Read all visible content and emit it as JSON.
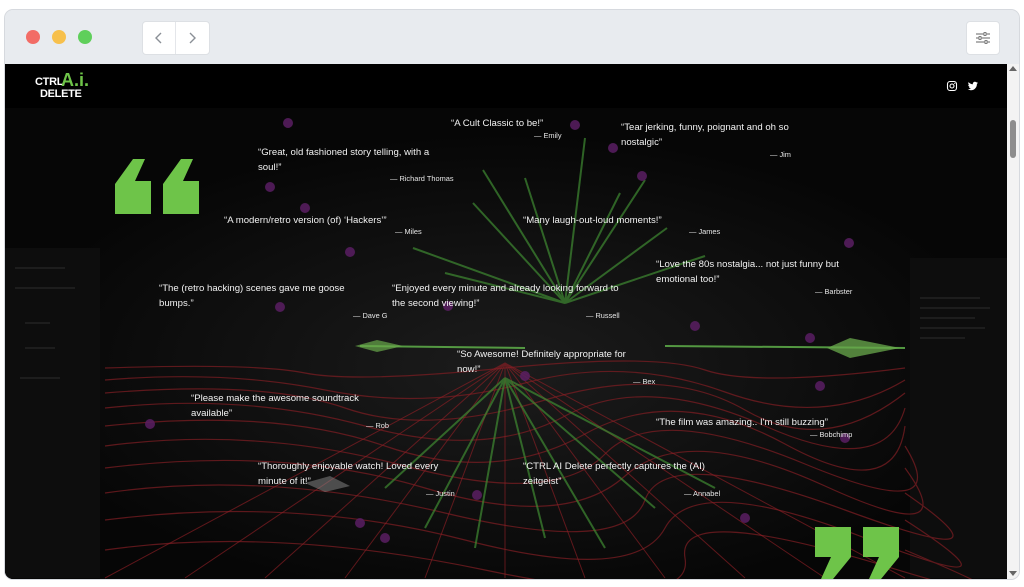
{
  "browser": {
    "back_icon": "chevron-left-icon",
    "forward_icon": "chevron-right-icon",
    "settings_icon": "sliders-icon"
  },
  "site": {
    "logo": {
      "line1": "CTRL",
      "ai": "A.i.",
      "line2": "DELETE"
    },
    "social": [
      "instagram-icon",
      "twitter-icon"
    ],
    "accent_color": "#6ec449"
  },
  "testimonials": [
    {
      "quote": "“A Cult Classic to be!”",
      "author": "— Emily"
    },
    {
      "quote": "“Tear jerking, funny, poignant and oh so nostalgic”",
      "author": "— Jim"
    },
    {
      "quote": "“Great, old fashioned story telling, with a soul!”",
      "author": "— Richard Thomas"
    },
    {
      "quote": "“A modern/retro version (of) ‘Hackers’”",
      "author": "— Miles"
    },
    {
      "quote": "“Many laugh-out-loud moments!”",
      "author": "— James"
    },
    {
      "quote": "“Love the 80s nostalgia... not just funny but emotional too!”",
      "author": "— Barbster"
    },
    {
      "quote": "“The (retro hacking) scenes gave me goose bumps.”",
      "author": "— Dave G"
    },
    {
      "quote": "“Enjoyed every minute and already looking forward to the second viewing!”",
      "author": "— Russell"
    },
    {
      "quote": "“So Awesome! Definitely appropriate for now!”",
      "author": "— Bex"
    },
    {
      "quote": "“Please make the awesome soundtrack available”",
      "author": "— Rob"
    },
    {
      "quote": "“The film was amazing.. I'm still buzzing”",
      "author": "— Bobchimp"
    },
    {
      "quote": "“Thoroughly enjoyable watch! Loved every minute of it!”",
      "author": "— Justin"
    },
    {
      "quote": "“CTRL AI Delete perfectly captures the (AI) zeitgeist”",
      "author": "— Annabel"
    }
  ]
}
